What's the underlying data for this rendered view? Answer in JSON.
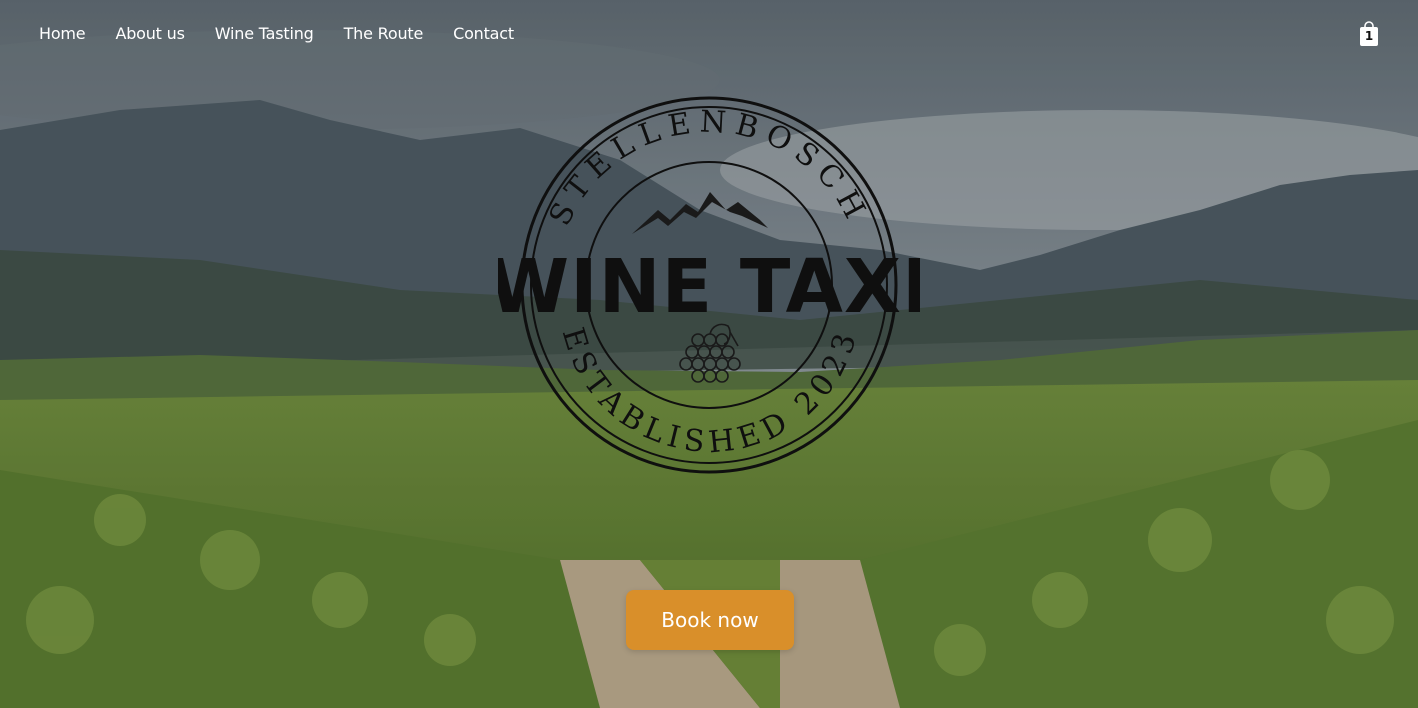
{
  "nav": {
    "items": [
      {
        "label": "Home"
      },
      {
        "label": "About us"
      },
      {
        "label": "Wine Tasting"
      },
      {
        "label": "The Route"
      },
      {
        "label": "Contact"
      }
    ]
  },
  "cart": {
    "icon": "shopping-bag-icon",
    "count": "1"
  },
  "logo": {
    "top_arc": "STELLENBOSCH",
    "title": "WINE TAXI",
    "bottom_arc": "ESTABLISHED 2023",
    "icons": [
      "mountains-icon",
      "grapes-icon"
    ]
  },
  "hero": {
    "background": "vineyard-mountains-photo",
    "cta_label": "Book now",
    "cta_color": "#d98f2a"
  }
}
